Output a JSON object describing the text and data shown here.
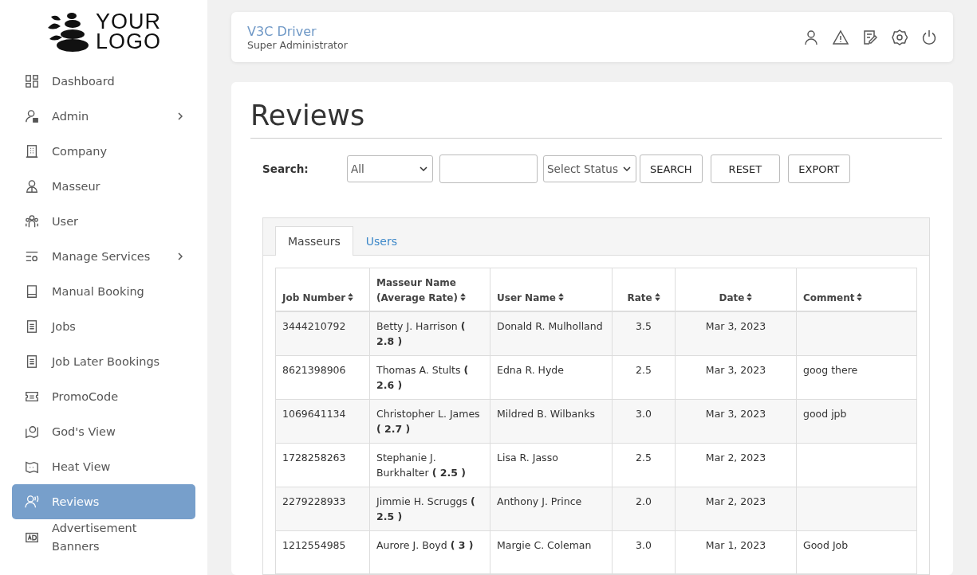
{
  "sidebar": {
    "logo": {
      "line_1": "YOUR",
      "line_2": "LOGO"
    },
    "items": [
      {
        "label": "Dashboard",
        "selected": false,
        "expandable": false
      },
      {
        "label": "Admin",
        "selected": false,
        "expandable": true
      },
      {
        "label": "Company",
        "selected": false,
        "expandable": false
      },
      {
        "label": "Masseur",
        "selected": false,
        "expandable": false
      },
      {
        "label": "User",
        "selected": false,
        "expandable": false
      },
      {
        "label": "Manage Services",
        "selected": false,
        "expandable": true
      },
      {
        "label": "Manual Booking",
        "selected": false,
        "expandable": false
      },
      {
        "label": "Jobs",
        "selected": false,
        "expandable": false
      },
      {
        "label": "Job Later Bookings",
        "selected": false,
        "expandable": false
      },
      {
        "label": "PromoCode",
        "selected": false,
        "expandable": false
      },
      {
        "label": "God's View",
        "selected": false,
        "expandable": false
      },
      {
        "label": "Heat View",
        "selected": false,
        "expandable": false
      },
      {
        "label": "Reviews",
        "selected": true,
        "expandable": false
      },
      {
        "label": "Advertisement Banners",
        "selected": false,
        "expandable": false
      }
    ]
  },
  "header": {
    "user_name": "V3C Driver",
    "role": "Super Administrator"
  },
  "page": {
    "title": "Reviews",
    "filters": {
      "label": "Search:",
      "field_select": "All",
      "status_select": "Select Status",
      "buttons": [
        "SEARCH",
        "RESET",
        "EXPORT"
      ]
    },
    "tabs": [
      {
        "label": "Masseurs",
        "selected": true
      },
      {
        "label": "Users",
        "selected": false
      }
    ],
    "table": {
      "columns": [
        "Job Number",
        "Masseur Name (Average Rate)",
        "User Name",
        "Rate",
        "Date",
        "Comment"
      ],
      "rows": [
        {
          "job_number": "3444210792",
          "masseur": "Betty J. Harrison **( 2.8 )**",
          "user": "Donald R. Mulholland",
          "rate": "3.5",
          "date": "Mar 3, 2023"
        },
        {
          "job_number": "8621398906",
          "masseur": "Thomas A. Stults **( 2.6 )**",
          "user": "Edna R. Hyde",
          "rate": "2.5",
          "date": "Mar 3, 2023",
          "comment": "goog there"
        },
        {
          "job_number": "1069641134",
          "masseur": "Christopher L. James **( 2.7 )**",
          "user": "Mildred B. Wilbanks",
          "rate": "3.0",
          "date": "Mar 3, 2023",
          "comment": "good jpb"
        },
        {
          "job_number": "1728258263",
          "masseur": "Stephanie J. Burkhalter **( 2.5 )**",
          "user": "Lisa R. Jasso",
          "rate": "2.5",
          "date": "Mar 2, 2023"
        },
        {
          "job_number": "2279228933",
          "masseur": "Jimmie H. Scruggs **( 2.5 )**",
          "user": "Anthony J. Prince",
          "rate": "2.0",
          "date": "Mar 2, 2023"
        },
        {
          "job_number": "1212554985",
          "masseur": "Aurore J. Boyd **( 3 )**",
          "user": "Margie C. Coleman",
          "rate": "3.0",
          "date": "Mar 1, 2023",
          "comment": "Good Job"
        }
      ]
    }
  }
}
